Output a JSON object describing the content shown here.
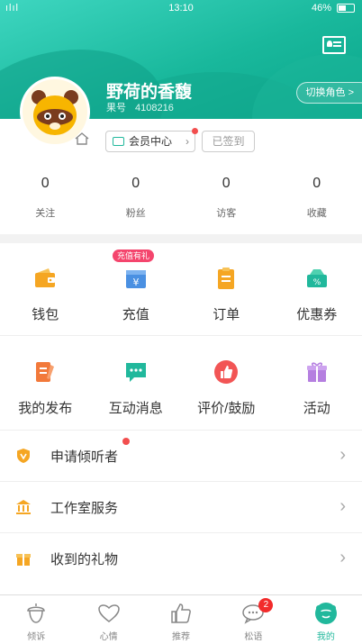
{
  "status_bar": {
    "signal": "ılıl",
    "time": "13:10",
    "battery": "46%"
  },
  "profile": {
    "username": "野荷的香馥",
    "id_label": "果号",
    "id_value": "4108216",
    "switch_role": "切换角色 >",
    "member_center": "会员中心",
    "signed_in": "已签到"
  },
  "stats": [
    {
      "value": "0",
      "label": "关注"
    },
    {
      "value": "0",
      "label": "粉丝"
    },
    {
      "value": "0",
      "label": "访客"
    },
    {
      "value": "0",
      "label": "收藏"
    }
  ],
  "grid": {
    "row1": [
      {
        "label": "钱包",
        "icon": "wallet-icon"
      },
      {
        "label": "充值",
        "icon": "recharge-icon",
        "tag": "充值有礼"
      },
      {
        "label": "订单",
        "icon": "order-icon"
      },
      {
        "label": "优惠券",
        "icon": "coupon-icon"
      }
    ],
    "row2": [
      {
        "label": "我的发布",
        "icon": "publish-icon"
      },
      {
        "label": "互动消息",
        "icon": "message-icon"
      },
      {
        "label": "评价/鼓励",
        "icon": "thumbs-up-icon"
      },
      {
        "label": "活动",
        "icon": "gift-icon"
      }
    ]
  },
  "list": [
    {
      "label": "申请倾听者",
      "icon": "shield-icon"
    },
    {
      "label": "工作室服务",
      "icon": "building-icon"
    },
    {
      "label": "收到的礼物",
      "icon": "gift-box-icon"
    }
  ],
  "tabbar": [
    {
      "label": "倾诉",
      "icon": "acorn-icon"
    },
    {
      "label": "心情",
      "icon": "heart-icon"
    },
    {
      "label": "推荐",
      "icon": "thumbs-up-icon"
    },
    {
      "label": "松语",
      "icon": "chat-icon",
      "badge": "2"
    },
    {
      "label": "我的",
      "icon": "user-icon"
    }
  ],
  "colors": {
    "accent": "#21b89c",
    "badge": "#f24e4e",
    "orange": "#f5a623",
    "blue": "#4a90e2"
  }
}
